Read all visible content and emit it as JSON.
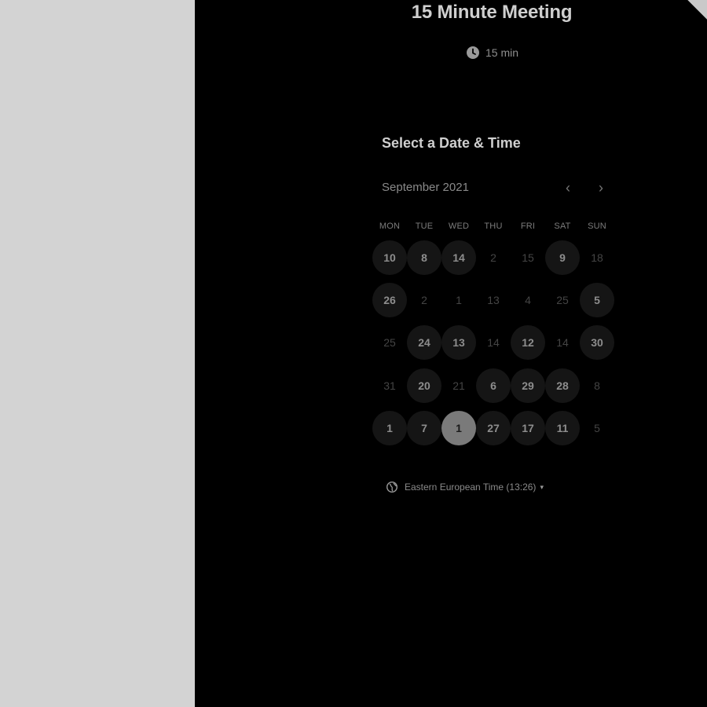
{
  "meeting": {
    "title": "15 Minute Meeting",
    "duration": "15 min",
    "duration_icon": "clock-icon"
  },
  "scheduler": {
    "section_title": "Select a Date & Time",
    "month": "September 2021",
    "prev_icon": "chevron-left-icon",
    "next_icon": "chevron-right-icon",
    "prev_glyph": "‹",
    "next_glyph": "›",
    "weekdays": [
      "MON",
      "TUE",
      "WED",
      "THU",
      "FRI",
      "SAT",
      "SUN"
    ],
    "weeks": [
      [
        {
          "d": "10",
          "a": true
        },
        {
          "d": "8",
          "a": true
        },
        {
          "d": "14",
          "a": true
        },
        {
          "d": "2",
          "a": false
        },
        {
          "d": "15",
          "a": false
        },
        {
          "d": "9",
          "a": true
        },
        {
          "d": "18",
          "a": false
        }
      ],
      [
        {
          "d": "26",
          "a": true
        },
        {
          "d": "2",
          "a": false
        },
        {
          "d": "1",
          "a": false
        },
        {
          "d": "13",
          "a": false
        },
        {
          "d": "4",
          "a": false
        },
        {
          "d": "25",
          "a": false
        },
        {
          "d": "5",
          "a": true
        }
      ],
      [
        {
          "d": "25",
          "a": false
        },
        {
          "d": "24",
          "a": true
        },
        {
          "d": "13",
          "a": true
        },
        {
          "d": "14",
          "a": false
        },
        {
          "d": "12",
          "a": true
        },
        {
          "d": "14",
          "a": false
        },
        {
          "d": "30",
          "a": true
        }
      ],
      [
        {
          "d": "31",
          "a": false
        },
        {
          "d": "20",
          "a": true
        },
        {
          "d": "21",
          "a": false
        },
        {
          "d": "6",
          "a": true
        },
        {
          "d": "29",
          "a": true
        },
        {
          "d": "28",
          "a": true
        },
        {
          "d": "8",
          "a": false
        }
      ],
      [
        {
          "d": "1",
          "a": true
        },
        {
          "d": "7",
          "a": true
        },
        {
          "d": "1",
          "a": true,
          "selected": true
        },
        {
          "d": "27",
          "a": true
        },
        {
          "d": "17",
          "a": true
        },
        {
          "d": "11",
          "a": true
        },
        {
          "d": "5",
          "a": false
        }
      ]
    ]
  },
  "timezone": {
    "label": "Eastern European Time (13:26)",
    "icon": "globe-icon",
    "caret": "▾"
  },
  "colors": {
    "panel_bg": "#000000",
    "page_bg": "#d3d3d3",
    "available_day_bg": "#151515",
    "selected_day_bg": "#7a7a7a"
  }
}
